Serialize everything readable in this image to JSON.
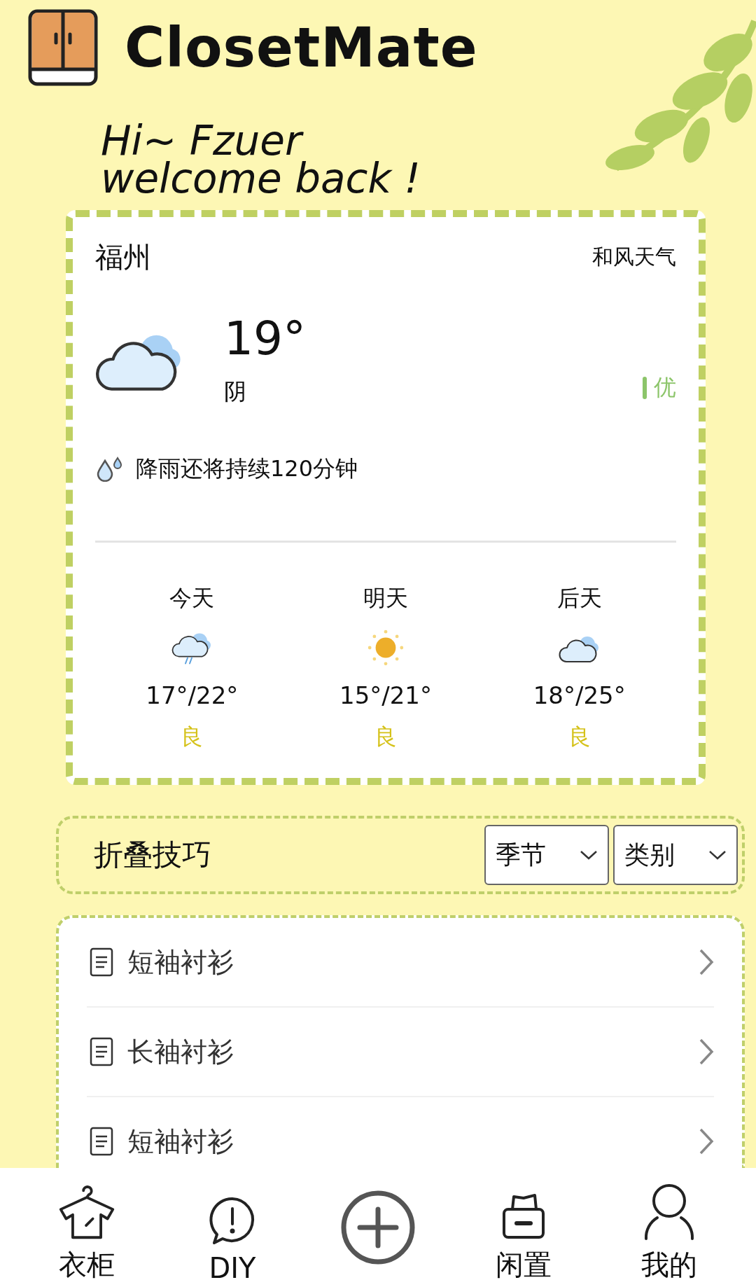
{
  "app": {
    "title": "ClosetMate"
  },
  "greeting": {
    "line_1": "Hi~ Fzuer",
    "line_2": "welcome back !"
  },
  "weather": {
    "city": "福州",
    "provider": "和风天气",
    "kind": "cloud",
    "temperature": "19°",
    "condition": "阴",
    "air_quality": "优",
    "rain_note": "降雨还将持续120分钟",
    "forecast": [
      {
        "day": "今天",
        "kind": "rain-cloud",
        "temps": "17°/22°",
        "air_quality": "良"
      },
      {
        "day": "明天",
        "kind": "sun",
        "temps": "15°/21°",
        "air_quality": "良"
      },
      {
        "day": "后天",
        "kind": "cloud",
        "temps": "18°/25°",
        "air_quality": "良"
      }
    ]
  },
  "filter_bar": {
    "title": "折叠技巧",
    "dropdowns": [
      "季节",
      "类别"
    ]
  },
  "tips": [
    {
      "label": "短袖衬衫"
    },
    {
      "label": "长袖衬衫"
    },
    {
      "label": "短袖衬衫"
    }
  ],
  "tab_bar": [
    {
      "kind": "wardrobe",
      "label": "衣柜"
    },
    {
      "kind": "diy",
      "label": "DIY"
    },
    {
      "kind": "add"
    },
    {
      "kind": "idle",
      "label": "闲置"
    },
    {
      "kind": "me",
      "label": "我的"
    }
  ]
}
